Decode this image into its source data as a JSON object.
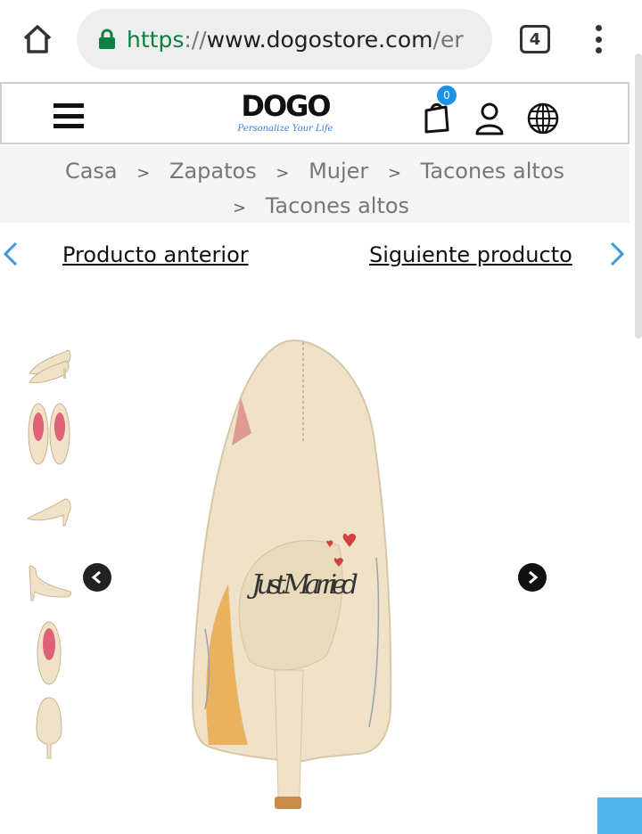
{
  "browser": {
    "url_scheme": "https",
    "url_sep": "://",
    "url_host": "www.dogostore.com",
    "url_rest": "/er",
    "tab_count": "4",
    "icons": [
      "home-icon",
      "lock-icon",
      "tabs-icon",
      "overflow-menu-icon"
    ]
  },
  "header": {
    "logo_main": "DOGO",
    "logo_tagline": "Personalize Your Life",
    "cart_count": "0",
    "icons": [
      "hamburger-menu-icon",
      "shopping-bag-icon",
      "user-icon",
      "globe-icon"
    ]
  },
  "breadcrumb": {
    "items": [
      "Casa",
      "Zapatos",
      "Mujer",
      "Tacones altos",
      "Tacones altos"
    ],
    "separator": ">"
  },
  "product_nav": {
    "prev_label": "Producto anterior",
    "next_label": "Siguiente producto"
  },
  "gallery": {
    "thumbnail_count": 6,
    "overlay_text": "Just Married",
    "colors": {
      "accent": "#3a9bdc",
      "badge": "#1e90e8",
      "shoe": "#efe2c8"
    }
  }
}
